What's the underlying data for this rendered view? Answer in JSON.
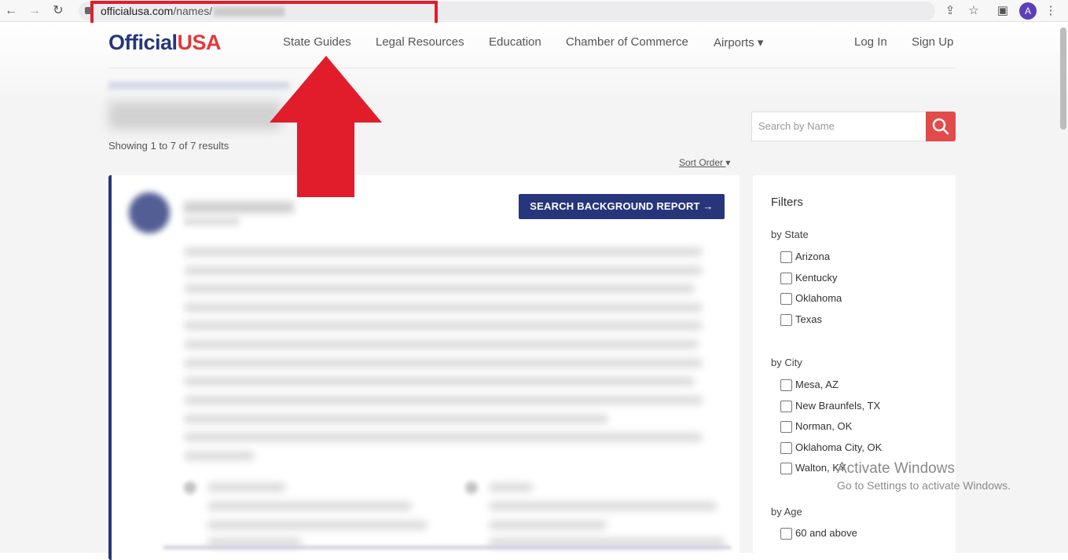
{
  "browser": {
    "url_host": "officialusa.com",
    "url_path": "/names/",
    "profile_initial": "A"
  },
  "site": {
    "logo_o": "O",
    "logo_fficial": "fficial",
    "logo_usa": "USA",
    "nav": [
      "State Guides",
      "Legal Resources",
      "Education",
      "Chamber of Commerce",
      "Airports"
    ],
    "airports_caret": "▾",
    "login": "Log In",
    "signup": "Sign Up"
  },
  "results": {
    "summary": "Showing 1 to 7 of 7 results",
    "sort_label": "Sort Order",
    "sort_caret": "▾"
  },
  "search": {
    "placeholder": "Search by Name"
  },
  "card": {
    "button_label": "SEARCH BACKGROUND REPORT →"
  },
  "filters": {
    "title": "Filters",
    "state_label": "by State",
    "states": [
      "Arizona",
      "Kentucky",
      "Oklahoma",
      "Texas"
    ],
    "city_label": "by City",
    "cities": [
      "Mesa, AZ",
      "New Braunfels, TX",
      "Norman, OK",
      "Oklahoma City, OK",
      "Walton, KY"
    ],
    "age_label": "by Age",
    "ages": [
      "60 and above"
    ]
  },
  "watermark": {
    "line1": "Activate Windows",
    "line2": "Go to Settings to activate Windows."
  },
  "colors": {
    "brand_navy": "#27367a",
    "brand_red": "#e23a3a",
    "annotation_red": "#e11d2b"
  }
}
